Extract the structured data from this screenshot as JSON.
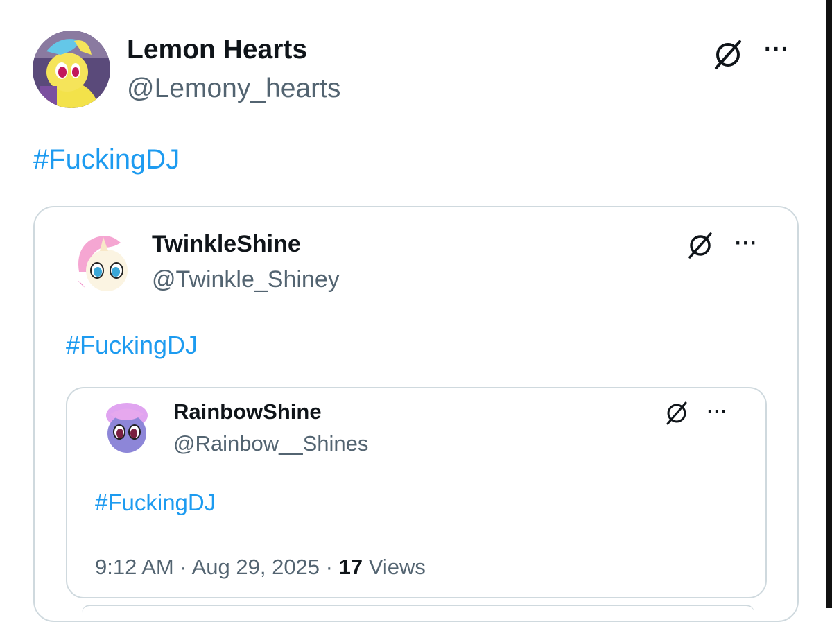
{
  "outer_post": {
    "display_name": "Lemon Hearts",
    "handle": "@Lemony_hearts",
    "text": "#FuckingDJ",
    "grok_icon": "grok-slash-icon",
    "more_label": "···"
  },
  "quoted_post": {
    "display_name": "TwinkleShine",
    "handle": "@Twinkle_Shiney",
    "text": "#FuckingDJ",
    "grok_icon": "grok-slash-icon",
    "more_label": "···"
  },
  "nested_quoted_post": {
    "display_name": "RainbowShine",
    "handle": "@Rainbow__Shines",
    "text": "#FuckingDJ",
    "grok_icon": "grok-slash-icon",
    "more_label": "···",
    "time": "9:12 AM",
    "sep1": " · ",
    "date": "Aug 29, 2025",
    "sep2": " · ",
    "views_count": "17",
    "views_label": " Views"
  },
  "colors": {
    "link": "#1d9bf0",
    "secondary_text": "#536471",
    "border": "#cfd9de"
  }
}
